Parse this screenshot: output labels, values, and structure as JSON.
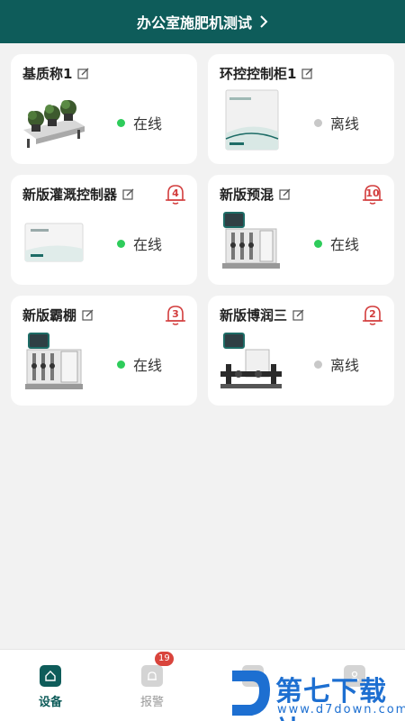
{
  "header": {
    "title": "办公室施肥机测试"
  },
  "devices": [
    {
      "name": "基质称1",
      "status": "在线",
      "online": true,
      "alarm": null
    },
    {
      "name": "环控控制柜1",
      "status": "离线",
      "online": false,
      "alarm": null
    },
    {
      "name": "新版灌溉控制器",
      "status": "在线",
      "online": true,
      "alarm": "4"
    },
    {
      "name": "新版预混",
      "status": "在线",
      "online": true,
      "alarm": "10"
    },
    {
      "name": "新版霸棚",
      "status": "在线",
      "online": true,
      "alarm": "3"
    },
    {
      "name": "新版博润三",
      "status": "离线",
      "online": false,
      "alarm": "2"
    }
  ],
  "tabbar": {
    "items": [
      {
        "label": "设备",
        "active": true
      },
      {
        "label": "报警",
        "active": false,
        "badge": "19"
      },
      {
        "label": "",
        "active": false
      },
      {
        "label": "",
        "active": false
      }
    ]
  },
  "watermark": {
    "title": "第七下载站",
    "url": "www.d7down.com"
  },
  "colors": {
    "primary": "#0e5c5a",
    "online": "#2ecc5b",
    "offline": "#c8c8c8",
    "alarm": "#d23c3c"
  }
}
